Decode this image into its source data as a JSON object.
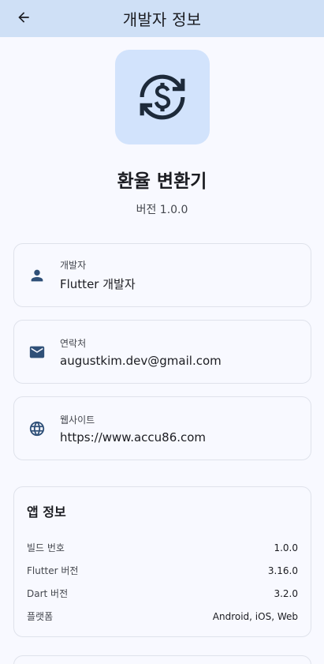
{
  "appbar": {
    "title": "개발자 정보",
    "back_icon": "arrow-back-icon"
  },
  "app": {
    "name": "환율 변환기",
    "version": "버전 1.0.0",
    "logo_icon": "currency-exchange-icon"
  },
  "contacts": [
    {
      "label": "개발자",
      "value": "Flutter 개발자",
      "icon": "person-icon"
    },
    {
      "label": "연락처",
      "value": "augustkim.dev@gmail.com",
      "icon": "email-icon"
    },
    {
      "label": "웹사이트",
      "value": "https://www.accu86.com",
      "icon": "globe-icon"
    }
  ],
  "app_info": {
    "title": "앱 정보",
    "rows": [
      {
        "key": "빌드 번호",
        "value": "1.0.0"
      },
      {
        "key": "Flutter 버전",
        "value": "3.16.0"
      },
      {
        "key": "Dart 버전",
        "value": "3.2.0"
      },
      {
        "key": "플랫폼",
        "value": "Android, iOS, Web"
      }
    ]
  },
  "colors": {
    "appbar": "#cfe0f6",
    "accent": "#2f5078",
    "logo_bg": "#d2e3fc",
    "background": "#f8f9ff"
  }
}
